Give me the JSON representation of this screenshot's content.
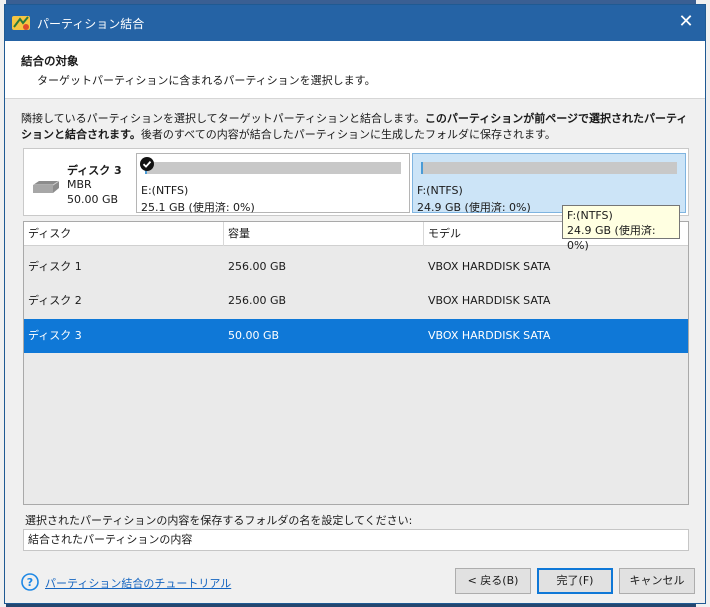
{
  "window": {
    "title": "パーティション結合",
    "close_symbol": "✕"
  },
  "header": {
    "title": "結合の対象",
    "subtitle": "ターゲットパーティションに含まれるパーティションを選択します。"
  },
  "description": {
    "part1": "隣接しているパーティションを選択してターゲットパーティションと結合します。",
    "part2_bold": "このパーティションが前ページで選択されたパーティションと結合されます。",
    "part3": "後者のすべての内容が結合したパーティションに生成したフォルダに保存されます。"
  },
  "disk_map": {
    "disk_name": "ディスク 3",
    "disk_type": "MBR",
    "disk_size": "50.00 GB",
    "partitions": [
      {
        "label": "E:(NTFS)",
        "size": "25.1 GB (使用済: 0%)",
        "checked": true,
        "used_fraction": 0.0
      },
      {
        "label": "F:(NTFS)",
        "size": "24.9 GB (使用済: 0%)",
        "checked": false,
        "used_fraction": 0.0
      }
    ]
  },
  "tooltip": {
    "line1": "F:(NTFS)",
    "line2": "24.9 GB (使用済: 0%)"
  },
  "disk_table": {
    "columns": [
      "ディスク",
      "容量",
      "モデル"
    ],
    "rows": [
      {
        "disk": "ディスク 1",
        "capacity": "256.00 GB",
        "model": "VBOX HARDDISK SATA",
        "selected": false
      },
      {
        "disk": "ディスク 2",
        "capacity": "256.00 GB",
        "model": "VBOX HARDDISK SATA",
        "selected": false
      },
      {
        "disk": "ディスク 3",
        "capacity": "50.00 GB",
        "model": "VBOX HARDDISK SATA",
        "selected": true
      }
    ]
  },
  "folder": {
    "label": "選択されたパーティションの内容を保存するフォルダの名を設定してください:",
    "value": "結合されたパーティションの内容"
  },
  "footer": {
    "help_link": "パーティション結合のチュートリアル",
    "back_label": "< 戻る(B)",
    "finish_label": "完了(F)",
    "cancel_label": "キャンセル"
  },
  "colors": {
    "titlebar": "#2563a5",
    "selection": "#0f78d7",
    "selected_partition": "#cce4f7",
    "tooltip_bg": "#ffffe1"
  }
}
